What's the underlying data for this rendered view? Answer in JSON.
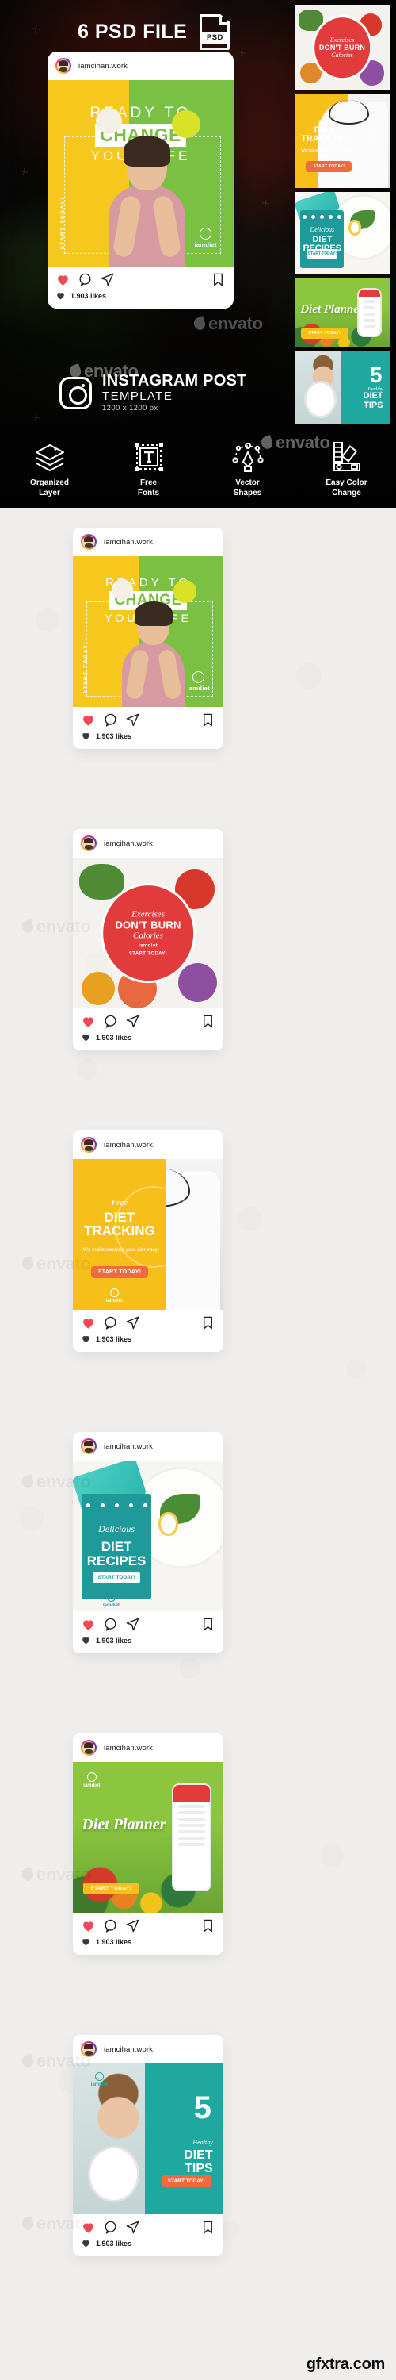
{
  "hero": {
    "psd_count_label": "6 PSD FILE",
    "psd_badge": "PSD",
    "template_title": "INSTAGRAM POST",
    "template_sub": "TEMPLATE",
    "template_size": "1200 x 1200 px",
    "watermark": "envato",
    "features": [
      {
        "label_1": "Organized",
        "label_2": "Layer",
        "icon": "layers-icon"
      },
      {
        "label_1": "Free",
        "label_2": "Fonts",
        "icon": "text-frame-icon"
      },
      {
        "label_1": "Vector",
        "label_2": "Shapes",
        "icon": "pen-tool-icon"
      },
      {
        "label_1": "Easy Color",
        "label_2": "Change",
        "icon": "color-swatch-icon"
      }
    ]
  },
  "instagram": {
    "username": "iamcihan.work",
    "likes_text": "1.903 likes",
    "heart_color": "#ed4956",
    "icons": [
      "heart-icon",
      "comment-icon",
      "share-icon",
      "bookmark-icon"
    ]
  },
  "posts": [
    {
      "id": "ready-to-change",
      "design": "change",
      "line1": "READY TO",
      "line2": "CHANGE",
      "line3": "YOUR LIFE",
      "vertical_text": "START TODAY!",
      "brand": "iamdiet",
      "colors": {
        "left": "#f6c71c",
        "right": "#7ac143"
      }
    },
    {
      "id": "exercises-dont-burn-calories",
      "design": "calories",
      "badge_line1": "Exercises",
      "badge_line2": "DON'T BURN",
      "badge_line3": "Calories",
      "badge_cta": "START TODAY!",
      "brand": "iamdiet",
      "colors": {
        "badge": "#e23b3b"
      }
    },
    {
      "id": "free-diet-tracking",
      "design": "tracking",
      "eyebrow": "Free",
      "title_line1": "DIET",
      "title_line2": "TRACKING",
      "subtitle": "We make tracking your diet easy!",
      "cta": "START TODAY!",
      "brand": "iamdiet",
      "colors": {
        "panel": "#f6bf1a",
        "cta": "#ef6a3c"
      }
    },
    {
      "id": "delicious-diet-recipes",
      "design": "recipes",
      "eyebrow": "Delicious",
      "title_line1": "DIET",
      "title_line2": "RECIPES",
      "cta": "START TODAY!",
      "brand": "iamdiet",
      "colors": {
        "panel": "#1f9a9a"
      }
    },
    {
      "id": "diet-planner",
      "design": "planner",
      "title": "Diet Planner",
      "cta": "START TODAY!",
      "brand": "iamdiet",
      "colors": {
        "bg": "#8cc63f",
        "cta": "#f6bf1a"
      }
    },
    {
      "id": "5-healthy-diet-tips",
      "design": "tips",
      "number": "5",
      "eyebrow": "Healthy",
      "title_line1": "DIET",
      "title_line2": "TIPS",
      "cta": "START TODAY!",
      "brand": "iamdiet",
      "colors": {
        "panel": "#1fa8a0",
        "cta": "#ef6a3c"
      }
    }
  ],
  "footer": {
    "site": "gfxtra.com"
  }
}
